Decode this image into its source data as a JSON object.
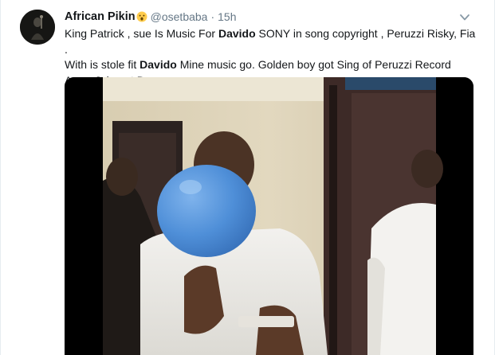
{
  "tweet": {
    "display_name": "African Pikin",
    "name_emoji": "surprised-face-emoji",
    "handle": "@osetbaba",
    "separator": "·",
    "time": "15h",
    "text_lines": [
      [
        "King Patrick ,  sue Is Music For ",
        "Davido",
        " SONY in song copyright , Peruzzi  Risky, Fia ."
      ],
      [
        "With is stole fit ",
        "Davido",
        " Mine music go. Golden boy got Sing of Peruzzi Record"
      ],
      [
        "Away Join out Dmw",
        "",
        ""
      ]
    ],
    "menu_icon": "chevron-down-icon",
    "media": {
      "type": "video",
      "description_icon": "video-frame"
    }
  },
  "colors": {
    "name": "#14171a",
    "secondary": "#657786",
    "border": "#e6ecf0",
    "balloon": "#4f8fd8"
  }
}
